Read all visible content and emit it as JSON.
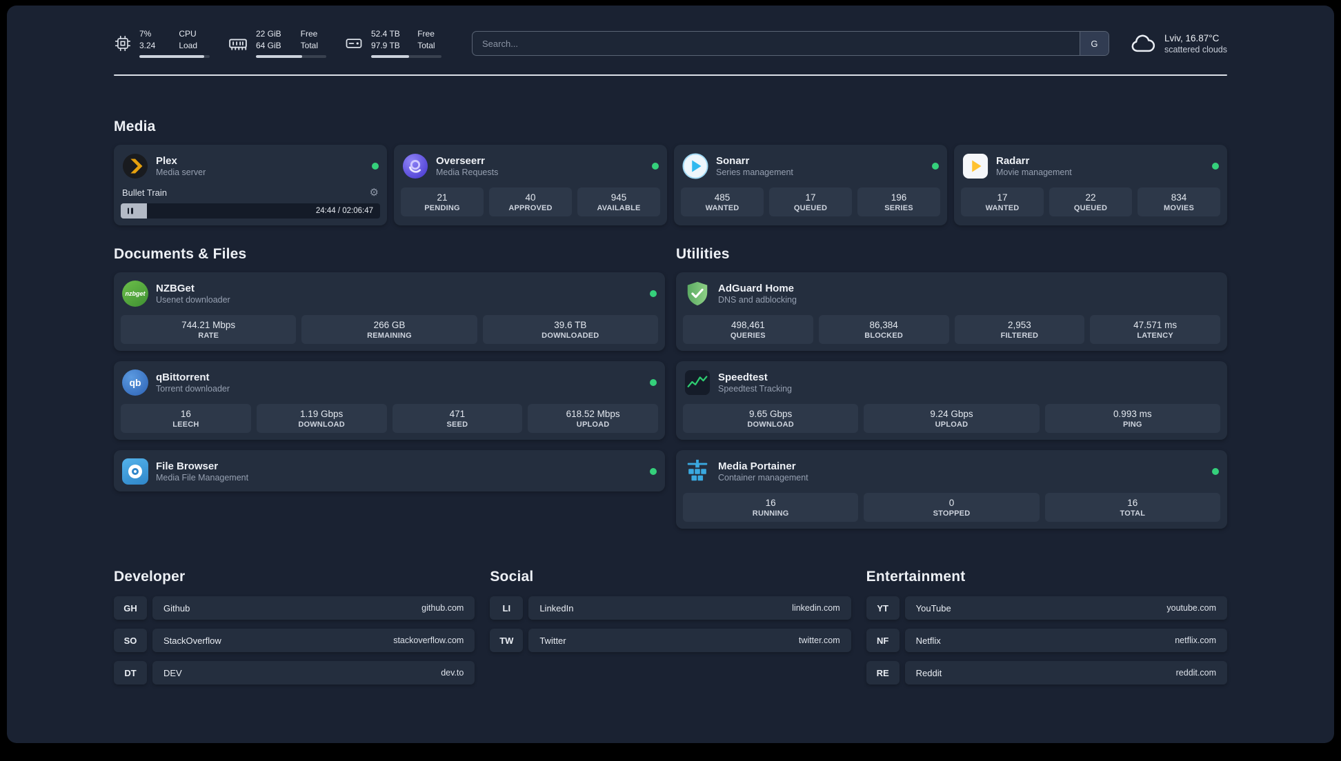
{
  "topbar": {
    "cpu": {
      "value_top": "7%",
      "value_bottom": "3.24",
      "label_top": "CPU",
      "label_bottom": "Load",
      "bar_percent": 92
    },
    "ram": {
      "value_top": "22 GiB",
      "value_bottom": "64 GiB",
      "label_top": "Free",
      "label_bottom": "Total",
      "bar_percent": 66
    },
    "disk": {
      "value_top": "52.4 TB",
      "value_bottom": "97.9 TB",
      "label_top": "Free",
      "label_bottom": "Total",
      "bar_percent": 54
    },
    "search": {
      "placeholder": "Search...",
      "engine_label": "G"
    },
    "weather": {
      "location": "Lviv, 16.87°C",
      "condition": "scattered clouds"
    }
  },
  "media": {
    "title": "Media",
    "plex": {
      "name": "Plex",
      "subtitle": "Media server",
      "now_playing": "Bullet Train",
      "time": "24:44 / 02:06:47",
      "progress_percent": 10
    },
    "overseerr": {
      "name": "Overseerr",
      "subtitle": "Media Requests",
      "stats": [
        {
          "value": "21",
          "label": "PENDING"
        },
        {
          "value": "40",
          "label": "APPROVED"
        },
        {
          "value": "945",
          "label": "AVAILABLE"
        }
      ]
    },
    "sonarr": {
      "name": "Sonarr",
      "subtitle": "Series management",
      "stats": [
        {
          "value": "485",
          "label": "WANTED"
        },
        {
          "value": "17",
          "label": "QUEUED"
        },
        {
          "value": "196",
          "label": "SERIES"
        }
      ]
    },
    "radarr": {
      "name": "Radarr",
      "subtitle": "Movie management",
      "stats": [
        {
          "value": "17",
          "label": "WANTED"
        },
        {
          "value": "22",
          "label": "QUEUED"
        },
        {
          "value": "834",
          "label": "MOVIES"
        }
      ]
    }
  },
  "documents": {
    "title": "Documents & Files",
    "nzbget": {
      "name": "NZBGet",
      "subtitle": "Usenet downloader",
      "icon_text": "nzbget",
      "stats": [
        {
          "value": "744.21 Mbps",
          "label": "RATE"
        },
        {
          "value": "266 GB",
          "label": "REMAINING"
        },
        {
          "value": "39.6 TB",
          "label": "DOWNLOADED"
        }
      ]
    },
    "qbittorrent": {
      "name": "qBittorrent",
      "subtitle": "Torrent downloader",
      "icon_text": "qb",
      "stats": [
        {
          "value": "16",
          "label": "LEECH"
        },
        {
          "value": "1.19 Gbps",
          "label": "DOWNLOAD"
        },
        {
          "value": "471",
          "label": "SEED"
        },
        {
          "value": "618.52 Mbps",
          "label": "UPLOAD"
        }
      ]
    },
    "filebrowser": {
      "name": "File Browser",
      "subtitle": "Media File Management"
    }
  },
  "utilities": {
    "title": "Utilities",
    "adguard": {
      "name": "AdGuard Home",
      "subtitle": "DNS and adblocking",
      "stats": [
        {
          "value": "498,461",
          "label": "QUERIES"
        },
        {
          "value": "86,384",
          "label": "BLOCKED"
        },
        {
          "value": "2,953",
          "label": "FILTERED"
        },
        {
          "value": "47.571 ms",
          "label": "LATENCY"
        }
      ]
    },
    "speedtest": {
      "name": "Speedtest",
      "subtitle": "Speedtest Tracking",
      "stats": [
        {
          "value": "9.65 Gbps",
          "label": "DOWNLOAD"
        },
        {
          "value": "9.24 Gbps",
          "label": "UPLOAD"
        },
        {
          "value": "0.993 ms",
          "label": "PING"
        }
      ]
    },
    "portainer": {
      "name": "Media Portainer",
      "subtitle": "Container management",
      "stats": [
        {
          "value": "16",
          "label": "RUNNING"
        },
        {
          "value": "0",
          "label": "STOPPED"
        },
        {
          "value": "16",
          "label": "TOTAL"
        }
      ]
    }
  },
  "bookmarks": [
    {
      "title": "Developer",
      "links": [
        {
          "abbr": "GH",
          "name": "Github",
          "url": "github.com"
        },
        {
          "abbr": "SO",
          "name": "StackOverflow",
          "url": "stackoverflow.com"
        },
        {
          "abbr": "DT",
          "name": "DEV",
          "url": "dev.to"
        }
      ]
    },
    {
      "title": "Social",
      "links": [
        {
          "abbr": "LI",
          "name": "LinkedIn",
          "url": "linkedin.com"
        },
        {
          "abbr": "TW",
          "name": "Twitter",
          "url": "twitter.com"
        }
      ]
    },
    {
      "title": "Entertainment",
      "links": [
        {
          "abbr": "YT",
          "name": "YouTube",
          "url": "youtube.com"
        },
        {
          "abbr": "NF",
          "name": "Netflix",
          "url": "netflix.com"
        },
        {
          "abbr": "RE",
          "name": "Reddit",
          "url": "reddit.com"
        }
      ]
    }
  ],
  "icons": {
    "gear": "⚙"
  }
}
